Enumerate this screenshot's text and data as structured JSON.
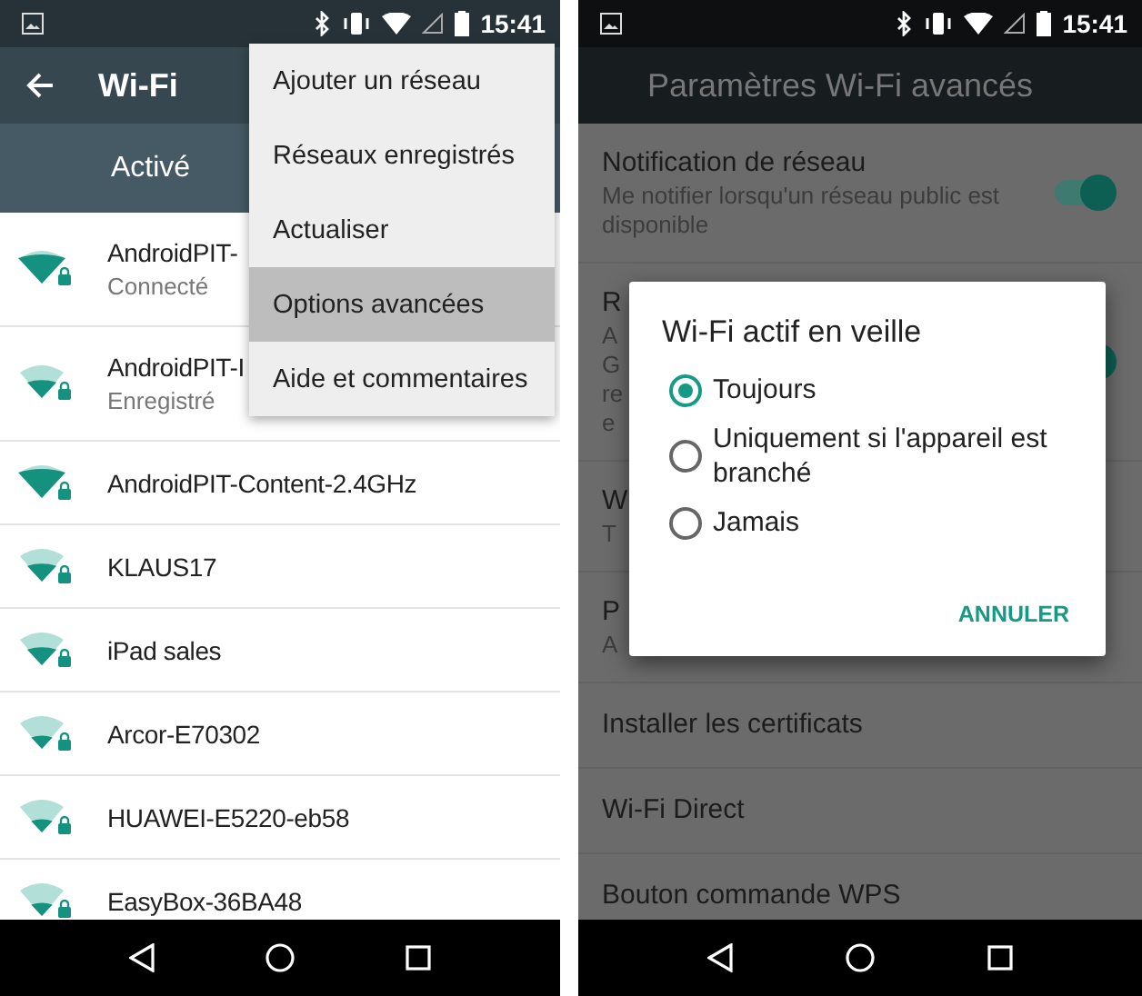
{
  "left_screen": {
    "status_bar": {
      "time": "15:41"
    },
    "toolbar": {
      "title": "Wi-Fi"
    },
    "switch_bar": {
      "label": "Activé"
    },
    "networks": [
      {
        "name": "AndroidPIT-",
        "status": "Connecté",
        "kind": "strong"
      },
      {
        "name": "AndroidPIT-I",
        "status": "Enregistré",
        "kind": "medium"
      },
      {
        "name": "AndroidPIT-Content-2.4GHz",
        "kind": "strong"
      },
      {
        "name": "KLAUS17",
        "kind": "medium"
      },
      {
        "name": "iPad sales",
        "kind": "medium"
      },
      {
        "name": "Arcor-E70302",
        "kind": "weak"
      },
      {
        "name": "HUAWEI-E5220-eb58",
        "kind": "weak"
      },
      {
        "name": "EasyBox-36BA48",
        "kind": "weak"
      }
    ],
    "overflow_menu": [
      {
        "label": "Ajouter un réseau",
        "selected": false
      },
      {
        "label": "Réseaux enregistrés",
        "selected": false
      },
      {
        "label": "Actualiser",
        "selected": false
      },
      {
        "label": "Options avancées",
        "selected": true
      },
      {
        "label": "Aide et commentaires",
        "selected": false
      }
    ]
  },
  "right_screen": {
    "status_bar": {
      "time": "15:41"
    },
    "toolbar": {
      "title": "Paramètres Wi-Fi avancés"
    },
    "settings": [
      {
        "title": "Notification de réseau",
        "summary": [
          "Me notifier lorsqu'un réseau public est",
          "disponible"
        ],
        "kind": "switch",
        "on": true
      },
      {
        "title": "R",
        "summary": [
          "A",
          "G",
          "re",
          "e"
        ],
        "kind": "switch",
        "on": true
      },
      {
        "title": "W",
        "summary": [
          "T"
        ],
        "kind": "plain"
      },
      {
        "title": "P",
        "summary": [
          "A"
        ],
        "kind": "plain"
      },
      {
        "title": "Installer les certificats",
        "kind": "plain"
      },
      {
        "title": "Wi-Fi Direct",
        "kind": "plain"
      },
      {
        "title": "Bouton commande WPS",
        "kind": "plain"
      }
    ],
    "dialog": {
      "title": "Wi-Fi actif en veille",
      "options": [
        {
          "label": "Toujours",
          "selected": true
        },
        {
          "label": "Uniquement si l'appareil est branché",
          "selected": false
        },
        {
          "label": "Jamais",
          "selected": false
        }
      ],
      "buttons": [
        "ANNULER"
      ]
    }
  }
}
